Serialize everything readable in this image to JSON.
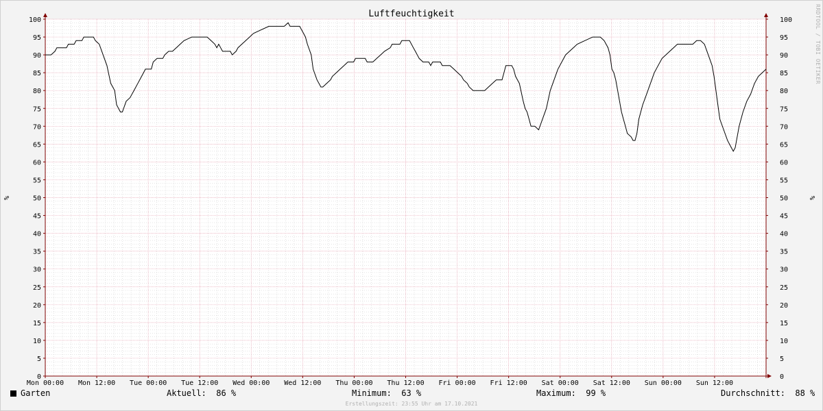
{
  "chart_data": {
    "type": "line",
    "title": "Luftfeuchtigkeit",
    "ylabel": "%",
    "ylim": [
      0,
      100
    ],
    "y_ticks": [
      "0",
      "5",
      "10",
      "15",
      "20",
      "25",
      "30",
      "35",
      "40",
      "45",
      "50",
      "55",
      "60",
      "65",
      "70",
      "75",
      "80",
      "85",
      "90",
      "95",
      "100"
    ],
    "x_ticks": [
      "Mon 00:00",
      "Mon 12:00",
      "Tue 00:00",
      "Tue 12:00",
      "Wed 00:00",
      "Wed 12:00",
      "Thu 00:00",
      "Thu 12:00",
      "Fri 00:00",
      "Fri 12:00",
      "Sat 00:00",
      "Sat 12:00",
      "Sun 00:00",
      "Sun 12:00"
    ],
    "x_unit": "hours since Mon 00:00",
    "xlim": [
      0,
      168
    ],
    "grid": true,
    "series": [
      {
        "name": "Garten",
        "color": "#000000",
        "points": [
          [
            0,
            90
          ],
          [
            1.5,
            90
          ],
          [
            2.5,
            91
          ],
          [
            3,
            92
          ],
          [
            5.5,
            92
          ],
          [
            6,
            93
          ],
          [
            7.5,
            93
          ],
          [
            8,
            94
          ],
          [
            9.5,
            94
          ],
          [
            10,
            95
          ],
          [
            12.5,
            95
          ],
          [
            13,
            94
          ],
          [
            14,
            93
          ],
          [
            15,
            90
          ],
          [
            16,
            87
          ],
          [
            17,
            82
          ],
          [
            17.5,
            81
          ],
          [
            18,
            80
          ],
          [
            18.5,
            76
          ],
          [
            19.5,
            74
          ],
          [
            20,
            74
          ],
          [
            21,
            77
          ],
          [
            22,
            78
          ],
          [
            23,
            80
          ],
          [
            24,
            82
          ],
          [
            25,
            84
          ],
          [
            26,
            86
          ],
          [
            27.5,
            86
          ],
          [
            28,
            88
          ],
          [
            29,
            89
          ],
          [
            30.5,
            89
          ],
          [
            31,
            90
          ],
          [
            32,
            91
          ],
          [
            33,
            91
          ],
          [
            34,
            92
          ],
          [
            35,
            93
          ],
          [
            36,
            94
          ],
          [
            38,
            95
          ],
          [
            42,
            95
          ],
          [
            43,
            94
          ],
          [
            44,
            93
          ],
          [
            44.5,
            92
          ],
          [
            45,
            93
          ],
          [
            45.5,
            92
          ],
          [
            46,
            91
          ],
          [
            48,
            91
          ],
          [
            48.5,
            90
          ],
          [
            49.5,
            91
          ],
          [
            50,
            92
          ],
          [
            51,
            93
          ],
          [
            52,
            94
          ],
          [
            53,
            95
          ],
          [
            54,
            96
          ],
          [
            56,
            97
          ],
          [
            58,
            98
          ],
          [
            62,
            98
          ],
          [
            63,
            99
          ],
          [
            63.5,
            98
          ],
          [
            66,
            98
          ],
          [
            67,
            96
          ],
          [
            67.5,
            95
          ],
          [
            68,
            93
          ],
          [
            69,
            90
          ],
          [
            69.5,
            86
          ],
          [
            70.5,
            83
          ],
          [
            71.5,
            81
          ],
          [
            72,
            81
          ],
          [
            73,
            82
          ],
          [
            74,
            83
          ],
          [
            74.5,
            84
          ],
          [
            75.5,
            85
          ],
          [
            76.5,
            86
          ],
          [
            77.5,
            87
          ],
          [
            78.5,
            88
          ],
          [
            80,
            88
          ],
          [
            80.5,
            89
          ],
          [
            83,
            89
          ],
          [
            83.5,
            88
          ],
          [
            85,
            88
          ],
          [
            86,
            89
          ],
          [
            87,
            90
          ],
          [
            88,
            91
          ],
          [
            89.5,
            92
          ],
          [
            90,
            93
          ],
          [
            92,
            93
          ],
          [
            92.5,
            94
          ],
          [
            94.5,
            94
          ],
          [
            95.5,
            92
          ],
          [
            96,
            91
          ],
          [
            97,
            89
          ],
          [
            98,
            88
          ],
          [
            99.5,
            88
          ],
          [
            100,
            87
          ],
          [
            100.5,
            88
          ],
          [
            102.5,
            88
          ],
          [
            103,
            87
          ],
          [
            105,
            87
          ],
          [
            106,
            86
          ],
          [
            107,
            85
          ],
          [
            108,
            84
          ],
          [
            108.5,
            83
          ],
          [
            109.5,
            82
          ],
          [
            110,
            81
          ],
          [
            111,
            80
          ],
          [
            113,
            80
          ],
          [
            114,
            80
          ],
          [
            115,
            81
          ],
          [
            116,
            82
          ],
          [
            117,
            83
          ],
          [
            118.5,
            83
          ],
          [
            119,
            85
          ],
          [
            119.5,
            87
          ],
          [
            121,
            87
          ],
          [
            121.5,
            86
          ],
          [
            122,
            84
          ],
          [
            123,
            82
          ],
          [
            124,
            77
          ],
          [
            124.5,
            75
          ],
          [
            125,
            74
          ],
          [
            125.5,
            72
          ],
          [
            126,
            70
          ],
          [
            127,
            70
          ],
          [
            128,
            69
          ],
          [
            129,
            72
          ],
          [
            130,
            75
          ],
          [
            131,
            80
          ],
          [
            132,
            83
          ],
          [
            133,
            86
          ],
          [
            134,
            88
          ],
          [
            135,
            90
          ],
          [
            136,
            91
          ],
          [
            137,
            92
          ],
          [
            138,
            93
          ],
          [
            140,
            94
          ],
          [
            142,
            95
          ],
          [
            144,
            95
          ],
          [
            145,
            94
          ],
          [
            146,
            92
          ],
          [
            146.5,
            90
          ],
          [
            147,
            86
          ],
          [
            147.5,
            85
          ],
          [
            148,
            83
          ],
          [
            148.5,
            80
          ],
          [
            149,
            77
          ],
          [
            149.5,
            74
          ],
          [
            150,
            72
          ],
          [
            150.5,
            70
          ],
          [
            151,
            68
          ],
          [
            152,
            67
          ],
          [
            152.5,
            66
          ],
          [
            153,
            66
          ],
          [
            153.5,
            68
          ],
          [
            154,
            72
          ],
          [
            155,
            76
          ],
          [
            156,
            79
          ],
          [
            157,
            82
          ],
          [
            158,
            85
          ],
          [
            159,
            87
          ],
          [
            160,
            89
          ],
          [
            161,
            90
          ],
          [
            162,
            91
          ],
          [
            163,
            92
          ],
          [
            164,
            93
          ],
          [
            168,
            93
          ],
          [
            169,
            94
          ],
          [
            170,
            94
          ],
          [
            171,
            93
          ],
          [
            172,
            90
          ],
          [
            173,
            87
          ],
          [
            173.5,
            84
          ],
          [
            174,
            80
          ],
          [
            174.5,
            76
          ],
          [
            175,
            72
          ],
          [
            176,
            69
          ],
          [
            177,
            66
          ],
          [
            178,
            64
          ],
          [
            178.5,
            63
          ],
          [
            179,
            64
          ],
          [
            180,
            70
          ],
          [
            181,
            74
          ],
          [
            182,
            77
          ],
          [
            183,
            79
          ],
          [
            184,
            82
          ],
          [
            185,
            84
          ],
          [
            186,
            85
          ],
          [
            187,
            86
          ]
        ]
      }
    ]
  },
  "legend": {
    "series_name": "Garten",
    "current_label": "Aktuell:",
    "current_value": "86 %",
    "min_label": "Minimum:",
    "min_value": "63 %",
    "max_label": "Maximum:",
    "max_value": "99 %",
    "avg_label": "Durchschnitt:",
    "avg_value": "88 %"
  },
  "footer_text": "Erstellungszeit: 23:55 Uhr am 17.10.2021",
  "watermark": "RRDTOOL / TOBI OETIKER",
  "colors": {
    "major_grid": "#e6a4b4",
    "minor_grid": "#c8c8c8",
    "axis": "#800000",
    "line": "#000000",
    "background": "#ffffff"
  }
}
